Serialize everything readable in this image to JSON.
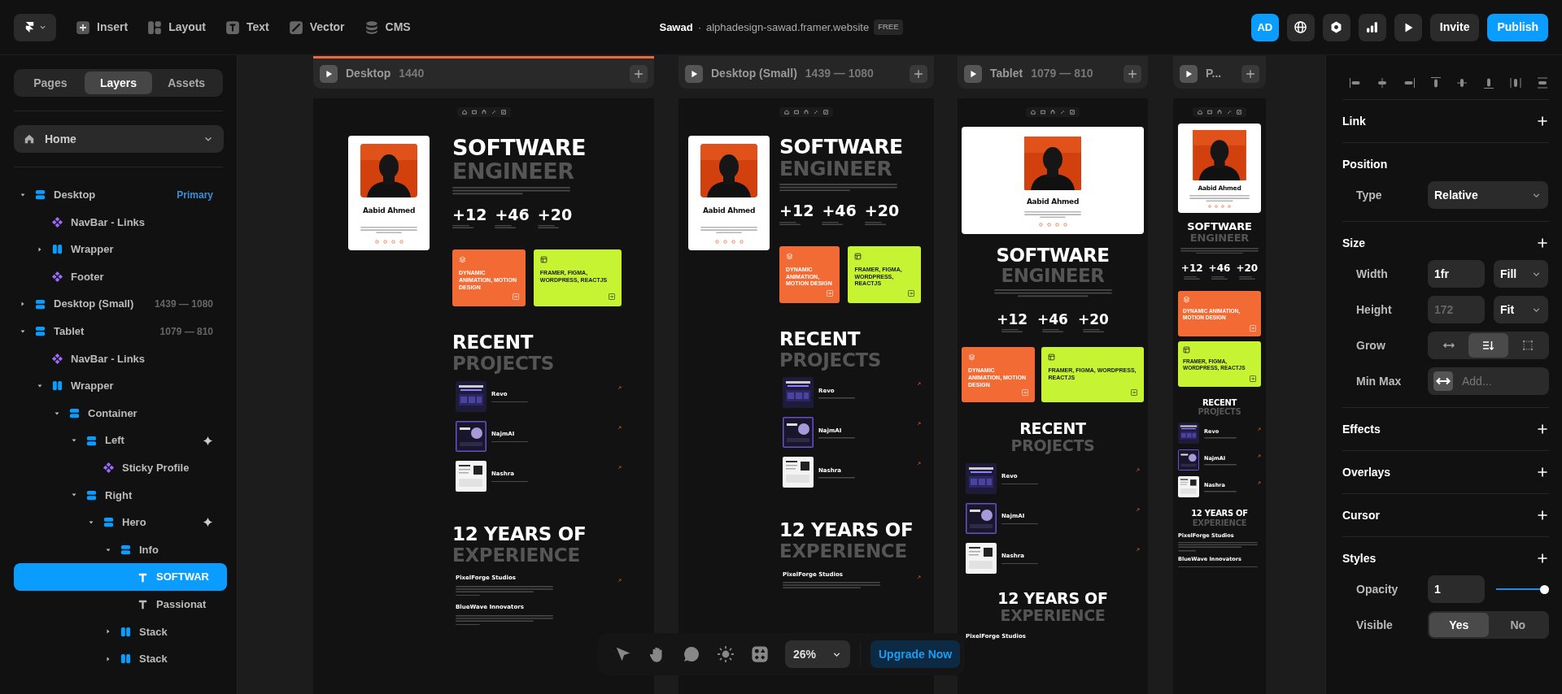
{
  "toolbar": {
    "menu_items": [
      {
        "label": "Insert",
        "kind": "insert"
      },
      {
        "label": "Layout",
        "kind": "layout"
      },
      {
        "label": "Text",
        "kind": "text"
      },
      {
        "label": "Vector",
        "kind": "vector"
      },
      {
        "label": "CMS",
        "kind": "cms"
      }
    ]
  },
  "project": {
    "name": "Sawad",
    "separator": "·",
    "domain": "alphadesign-sawad.framer.website",
    "plan": "FREE"
  },
  "actions": {
    "avatar": "AD",
    "invite": "Invite",
    "publish": "Publish"
  },
  "sidebar": {
    "tabs": [
      {
        "label": "Pages",
        "selected": false
      },
      {
        "label": "Layers",
        "selected": true
      },
      {
        "label": "Assets",
        "selected": false
      }
    ],
    "page": "Home",
    "layers": [
      {
        "label": "Desktop",
        "kind": "frame",
        "expanded": true,
        "selected": false,
        "tag": "Primary",
        "children": [
          {
            "label": "NavBar - Links",
            "kind": "component",
            "selected": false
          },
          {
            "label": "Wrapper",
            "kind": "stack",
            "expanded": false,
            "selected": false
          },
          {
            "label": "Footer",
            "kind": "component",
            "selected": false
          }
        ]
      },
      {
        "label": "Desktop (Small)",
        "kind": "frame",
        "expanded": false,
        "selected": false,
        "size": "1439 — 1080"
      },
      {
        "label": "Tablet",
        "kind": "frame",
        "expanded": true,
        "selected": false,
        "size": "1079 — 810",
        "children": [
          {
            "label": "NavBar - Links",
            "kind": "component",
            "selected": false
          },
          {
            "label": "Wrapper",
            "kind": "stack",
            "expanded": true,
            "selected": false,
            "children": [
              {
                "label": "Container",
                "kind": "frame",
                "expanded": true,
                "selected": false,
                "children": [
                  {
                    "label": "Left",
                    "kind": "frame",
                    "expanded": true,
                    "selected": false,
                    "sparkle": true,
                    "children": [
                      {
                        "label": "Sticky Profile",
                        "kind": "component",
                        "selected": false
                      }
                    ]
                  },
                  {
                    "label": "Right",
                    "kind": "frame",
                    "expanded": true,
                    "selected": false,
                    "children": [
                      {
                        "label": "Hero",
                        "kind": "frame",
                        "expanded": true,
                        "selected": false,
                        "sparkle": true,
                        "children": [
                          {
                            "label": "Info",
                            "kind": "frame",
                            "expanded": true,
                            "selected": false,
                            "children": [
                              {
                                "label": "SOFTWAR",
                                "kind": "text",
                                "selected": true
                              },
                              {
                                "label": "Passionat",
                                "kind": "text",
                                "selected": false
                              }
                            ]
                          },
                          {
                            "label": "Stack",
                            "kind": "stack",
                            "expanded": false,
                            "selected": false
                          },
                          {
                            "label": "Stack",
                            "kind": "stack",
                            "expanded": false,
                            "selected": false
                          }
                        ]
                      }
                    ]
                  }
                ]
              }
            ]
          }
        ]
      }
    ]
  },
  "canvas": {
    "frames": [
      {
        "label": "Desktop",
        "size": "1440",
        "selected": true,
        "profile": {
          "name": "Aabid Ahmed"
        },
        "title": [
          "SOFTWARE",
          "ENGINEER"
        ],
        "stats": [
          {
            "value": "+12"
          },
          {
            "value": "+46"
          },
          {
            "value": "+20"
          }
        ],
        "services": [
          {
            "title": "DYNAMIC ANIMATION, MOTION DESIGN",
            "color": "#f26b35"
          },
          {
            "title": "FRAMER, FIGMA, WORDPRESS, REACTJS",
            "color": "#c6f432"
          }
        ],
        "projects_title": [
          "RECENT",
          "PROJECTS"
        ],
        "projects": [
          {
            "name": "Revo"
          },
          {
            "name": "NajmAI"
          },
          {
            "name": "Nashra"
          }
        ],
        "experience_title": [
          "12 YEARS OF",
          "EXPERIENCE"
        ],
        "jobs": [
          {
            "company": "PixelForge Studios"
          },
          {
            "company": "BlueWave Innovators"
          }
        ]
      },
      {
        "label": "Desktop (Small)",
        "size": "1439 — 1080",
        "selected": false,
        "profile": {
          "name": "Aabid Ahmed"
        },
        "title": [
          "SOFTWARE",
          "ENGINEER"
        ],
        "stats": [
          {
            "value": "+12"
          },
          {
            "value": "+46"
          },
          {
            "value": "+20"
          }
        ],
        "services": [
          {
            "title": "DYNAMIC ANIMATION, MOTION DESIGN",
            "color": "#f26b35"
          },
          {
            "title": "FRAMER, FIGMA, WORDPRESS, REACTJS",
            "color": "#c6f432"
          }
        ],
        "projects_title": [
          "RECENT",
          "PROJECTS"
        ],
        "projects": [
          {
            "name": "Revo"
          },
          {
            "name": "NajmAI"
          },
          {
            "name": "Nashra"
          }
        ],
        "experience_title": [
          "12 YEARS OF",
          "EXPERIENCE"
        ],
        "jobs": [
          {
            "company": "PixelForge Studios"
          }
        ]
      },
      {
        "label": "Tablet",
        "size": "1079 — 810",
        "selected": false,
        "profile": {
          "name": "Aabid Ahmed"
        },
        "title": [
          "SOFTWARE",
          "ENGINEER"
        ],
        "stats": [
          {
            "value": "+12"
          },
          {
            "value": "+46"
          },
          {
            "value": "+20"
          }
        ],
        "services": [
          {
            "title": "DYNAMIC ANIMATION, MOTION DESIGN",
            "color": "#f26b35"
          },
          {
            "title": "FRAMER, FIGMA, WORDPRESS, REACTJS",
            "color": "#c6f432"
          }
        ],
        "projects_title": [
          "RECENT",
          "PROJECTS"
        ],
        "projects": [
          {
            "name": "Revo"
          },
          {
            "name": "NajmAI"
          },
          {
            "name": "Nashra"
          }
        ],
        "experience_title": [
          "12 YEARS OF",
          "EXPERIENCE"
        ],
        "jobs": [
          {
            "company": "PixelForge Studios"
          }
        ]
      },
      {
        "label": "P...",
        "selected": false,
        "profile": {
          "name": "Aabid Ahmed"
        },
        "title": [
          "SOFTWARE",
          "ENGINEER"
        ],
        "stats": [
          {
            "value": "+12"
          },
          {
            "value": "+46"
          },
          {
            "value": "+20"
          }
        ],
        "services": [
          {
            "title": "DYNAMIC ANIMATION, MOTION DESIGN",
            "color": "#f26b35"
          },
          {
            "title": "FRAMER, FIGMA, WORDPRESS, REACTJS",
            "color": "#c6f432"
          }
        ],
        "projects_title": [
          "RECENT",
          "PROJECTS"
        ],
        "projects": [
          {
            "name": "Revo"
          },
          {
            "name": "NajmAI"
          },
          {
            "name": "Nashra"
          }
        ],
        "experience_title": [
          "12 YEARS OF",
          "EXPERIENCE"
        ],
        "jobs": [
          {
            "company": "PixelForge Studios"
          },
          {
            "company": "BlueWave Innovators"
          }
        ]
      }
    ]
  },
  "bottom_toolbar": {
    "zoom": "26%",
    "upgrade": "Upgrade Now"
  },
  "properties": {
    "link": {
      "title": "Link"
    },
    "position": {
      "title": "Position",
      "type_label": "Type",
      "type_value": "Relative"
    },
    "size": {
      "title": "Size",
      "width_label": "Width",
      "width_value": "1fr",
      "width_mode": "Fill",
      "height_label": "Height",
      "height_placeholder": "172",
      "height_mode": "Fit",
      "grow_label": "Grow",
      "grow_options": [
        {
          "kind": "horizontal",
          "selected": false
        },
        {
          "kind": "wrap",
          "selected": true
        },
        {
          "kind": "fixed",
          "selected": false
        }
      ],
      "minmax_label": "Min Max",
      "minmax_placeholder": "Add..."
    },
    "collapsed": [
      {
        "title": "Effects"
      },
      {
        "title": "Overlays"
      },
      {
        "title": "Cursor"
      }
    ],
    "styles": {
      "title": "Styles",
      "opacity_label": "Opacity",
      "opacity_value": "1",
      "opacity": {
        "level": 1
      },
      "visible_label": "Visible",
      "visible_options": [
        {
          "label": "Yes",
          "selected": true
        },
        {
          "label": "No",
          "selected": false
        }
      ]
    }
  }
}
